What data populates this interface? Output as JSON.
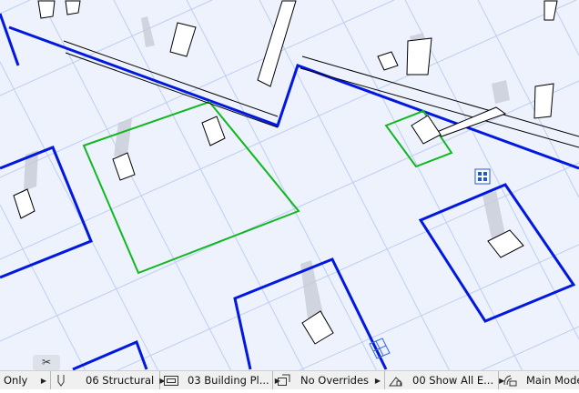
{
  "statusbar": {
    "items": [
      {
        "label": "Only",
        "icon": "none"
      },
      {
        "label": "06 Structural",
        "icon": "pen-set-icon"
      },
      {
        "label": "03 Building Pl...",
        "icon": "model-view-icon"
      },
      {
        "label": "No Overrides",
        "icon": "graphic-override-icon"
      },
      {
        "label": "00 Show All E...",
        "icon": "renovation-filter-icon"
      },
      {
        "label": "Main Mode",
        "icon": "structural-function-icon"
      }
    ]
  },
  "colors": {
    "grid": "#b9cdf2",
    "walls_blue": "#0018e0",
    "selection_green": "#10b820",
    "background": "#eef2fc"
  }
}
